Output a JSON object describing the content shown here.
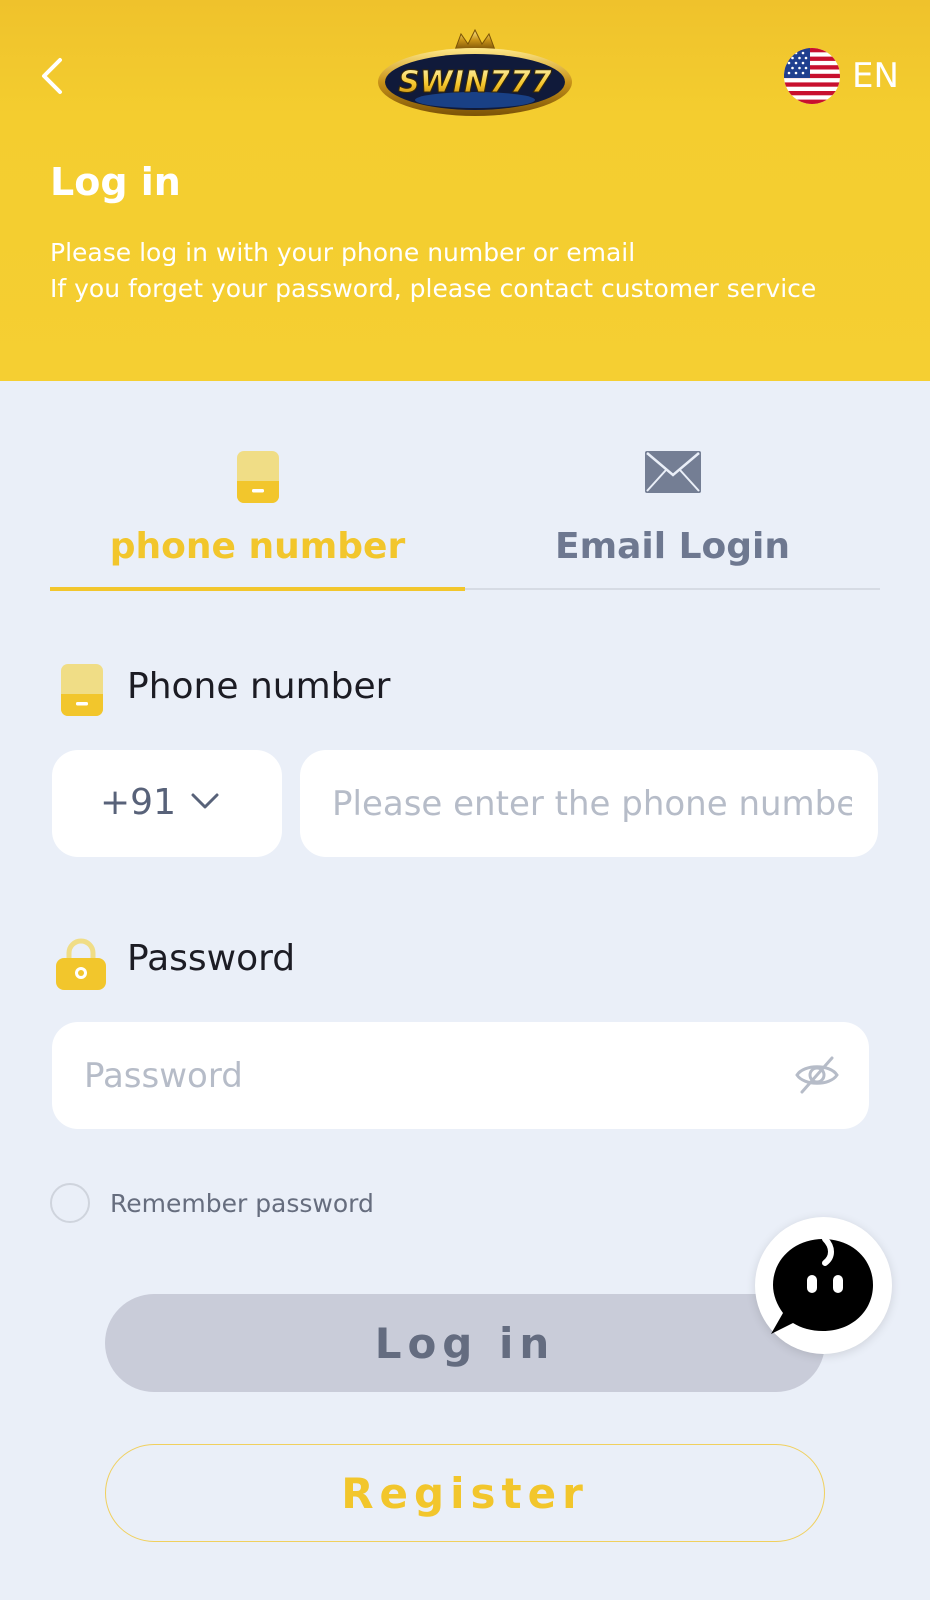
{
  "header": {
    "logo_text": "SWIN777",
    "language": "EN",
    "title": "Log in",
    "subtitle_line1": "Please log in with your phone number or email",
    "subtitle_line2": "If you forget your password, please contact customer service",
    "background_color": "#f5cf32"
  },
  "tabs": [
    {
      "label": "phone number",
      "icon": "phone-icon",
      "active": true
    },
    {
      "label": "Email Login",
      "icon": "mail-icon",
      "active": false
    }
  ],
  "phone_field": {
    "label": "Phone number",
    "country_code": "+91",
    "placeholder": "Please enter the phone number"
  },
  "password_field": {
    "label": "Password",
    "placeholder": "Password"
  },
  "remember": {
    "label": "Remember password",
    "checked": false
  },
  "buttons": {
    "login": "Log in",
    "register": "Register"
  },
  "colors": {
    "accent": "#f2c62c",
    "page_background": "#eaeff8",
    "login_button_disabled": "#c9ccd9"
  }
}
